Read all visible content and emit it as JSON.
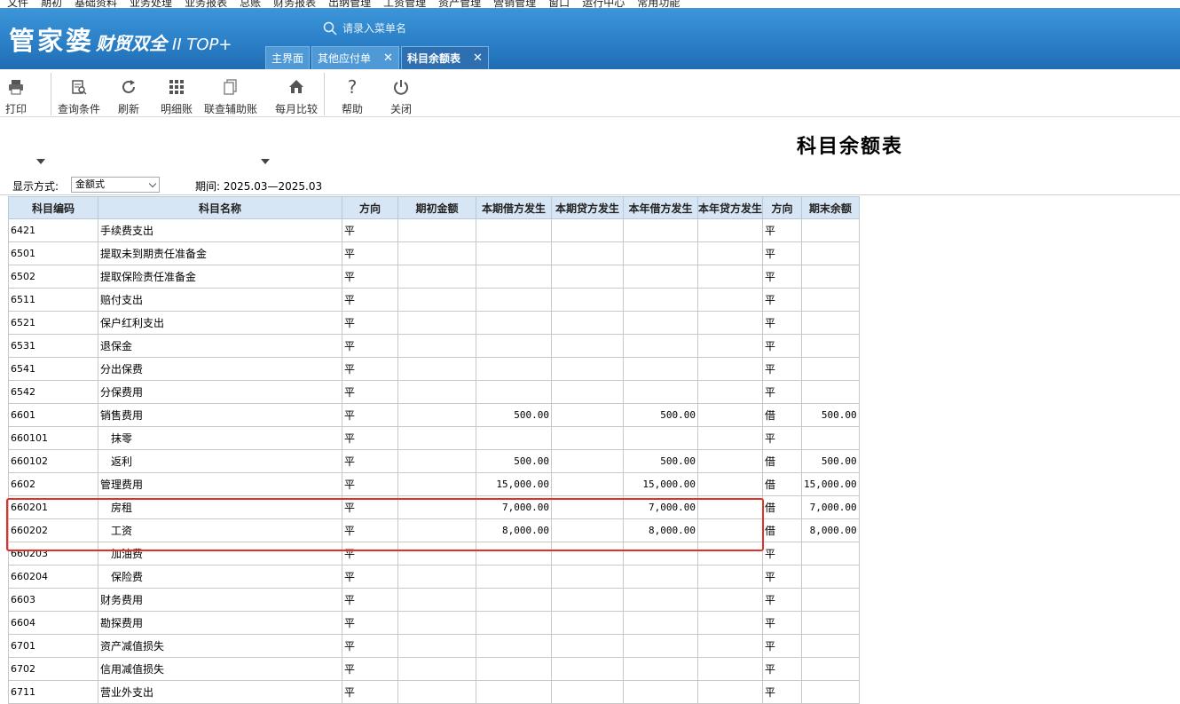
{
  "menubar": {
    "items": [
      "文件",
      "期初",
      "基础资料",
      "业务处理",
      "业务报表",
      "总账",
      "财务报表",
      "出纳管理",
      "工资管理",
      "资产管理",
      "營销管理",
      "窗口",
      "运行中心",
      "常用功能"
    ]
  },
  "brand": {
    "name": "管家婆",
    "subname": "财贸双全",
    "version": "II TOP+"
  },
  "search": {
    "placeholder": "请录入菜单名"
  },
  "tabs": [
    {
      "label": "主界面",
      "closable": false,
      "active": false
    },
    {
      "label": "其他应付单",
      "closable": true,
      "active": false
    },
    {
      "label": "科目余额表",
      "closable": true,
      "active": true
    }
  ],
  "toolbar": {
    "print": "打印",
    "query": "查询条件",
    "refresh": "刷新",
    "detail": "明细账",
    "linked": "联查辅助账",
    "monthly": "每月比较",
    "help": "帮助",
    "close": "关闭"
  },
  "report": {
    "title": "科目余额表",
    "display_mode_label": "显示方式:",
    "display_mode_value": "金额式",
    "period_label": "期间: 2025.03—2025.03"
  },
  "table": {
    "columns": [
      "科目编码",
      "科目名称",
      "方向",
      "期初金额",
      "本期借方发生",
      "本期贷方发生",
      "本年借方发生",
      "本年贷方发生",
      "方向",
      "期末余额"
    ],
    "rows": [
      {
        "code": "6421",
        "name": "手续费支出",
        "dir1": "平",
        "open": "",
        "cur_debit": "",
        "cur_credit": "",
        "ytd_debit": "",
        "ytd_credit": "",
        "dir2": "平",
        "end": ""
      },
      {
        "code": "6501",
        "name": "提取未到期责任准备金",
        "dir1": "平",
        "open": "",
        "cur_debit": "",
        "cur_credit": "",
        "ytd_debit": "",
        "ytd_credit": "",
        "dir2": "平",
        "end": ""
      },
      {
        "code": "6502",
        "name": "提取保险责任准备金",
        "dir1": "平",
        "open": "",
        "cur_debit": "",
        "cur_credit": "",
        "ytd_debit": "",
        "ytd_credit": "",
        "dir2": "平",
        "end": ""
      },
      {
        "code": "6511",
        "name": "赔付支出",
        "dir1": "平",
        "open": "",
        "cur_debit": "",
        "cur_credit": "",
        "ytd_debit": "",
        "ytd_credit": "",
        "dir2": "平",
        "end": ""
      },
      {
        "code": "6521",
        "name": "保户红利支出",
        "dir1": "平",
        "open": "",
        "cur_debit": "",
        "cur_credit": "",
        "ytd_debit": "",
        "ytd_credit": "",
        "dir2": "平",
        "end": ""
      },
      {
        "code": "6531",
        "name": "退保金",
        "dir1": "平",
        "open": "",
        "cur_debit": "",
        "cur_credit": "",
        "ytd_debit": "",
        "ytd_credit": "",
        "dir2": "平",
        "end": ""
      },
      {
        "code": "6541",
        "name": "分出保费",
        "dir1": "平",
        "open": "",
        "cur_debit": "",
        "cur_credit": "",
        "ytd_debit": "",
        "ytd_credit": "",
        "dir2": "平",
        "end": ""
      },
      {
        "code": "6542",
        "name": "分保费用",
        "dir1": "平",
        "open": "",
        "cur_debit": "",
        "cur_credit": "",
        "ytd_debit": "",
        "ytd_credit": "",
        "dir2": "平",
        "end": ""
      },
      {
        "code": "6601",
        "name": "销售费用",
        "dir1": "平",
        "open": "",
        "cur_debit": "500.00",
        "cur_credit": "",
        "ytd_debit": "500.00",
        "ytd_credit": "",
        "dir2": "借",
        "end": "500.00"
      },
      {
        "code": "660101",
        "name": "抹零",
        "child": true,
        "dir1": "平",
        "open": "",
        "cur_debit": "",
        "cur_credit": "",
        "ytd_debit": "",
        "ytd_credit": "",
        "dir2": "平",
        "end": ""
      },
      {
        "code": "660102",
        "name": "返利",
        "child": true,
        "dir1": "平",
        "open": "",
        "cur_debit": "500.00",
        "cur_credit": "",
        "ytd_debit": "500.00",
        "ytd_credit": "",
        "dir2": "借",
        "end": "500.00"
      },
      {
        "code": "6602",
        "name": "管理费用",
        "dir1": "平",
        "open": "",
        "cur_debit": "15,000.00",
        "cur_credit": "",
        "ytd_debit": "15,000.00",
        "ytd_credit": "",
        "dir2": "借",
        "end": "15,000.00"
      },
      {
        "code": "660201",
        "name": "房租",
        "child": true,
        "dir1": "平",
        "open": "",
        "cur_debit": "7,000.00",
        "cur_credit": "",
        "ytd_debit": "7,000.00",
        "ytd_credit": "",
        "dir2": "借",
        "end": "7,000.00"
      },
      {
        "code": "660202",
        "name": "工资",
        "child": true,
        "dir1": "平",
        "open": "",
        "cur_debit": "8,000.00",
        "cur_credit": "",
        "ytd_debit": "8,000.00",
        "ytd_credit": "",
        "dir2": "借",
        "end": "8,000.00"
      },
      {
        "code": "660203",
        "name": "加油费",
        "child": true,
        "dir1": "平",
        "open": "",
        "cur_debit": "",
        "cur_credit": "",
        "ytd_debit": "",
        "ytd_credit": "",
        "dir2": "平",
        "end": ""
      },
      {
        "code": "660204",
        "name": "保险费",
        "child": true,
        "dir1": "平",
        "open": "",
        "cur_debit": "",
        "cur_credit": "",
        "ytd_debit": "",
        "ytd_credit": "",
        "dir2": "平",
        "end": ""
      },
      {
        "code": "6603",
        "name": "财务费用",
        "dir1": "平",
        "open": "",
        "cur_debit": "",
        "cur_credit": "",
        "ytd_debit": "",
        "ytd_credit": "",
        "dir2": "平",
        "end": ""
      },
      {
        "code": "6604",
        "name": "勘探费用",
        "dir1": "平",
        "open": "",
        "cur_debit": "",
        "cur_credit": "",
        "ytd_debit": "",
        "ytd_credit": "",
        "dir2": "平",
        "end": ""
      },
      {
        "code": "6701",
        "name": "资产减值损失",
        "dir1": "平",
        "open": "",
        "cur_debit": "",
        "cur_credit": "",
        "ytd_debit": "",
        "ytd_credit": "",
        "dir2": "平",
        "end": ""
      },
      {
        "code": "6702",
        "name": "信用减值损失",
        "dir1": "平",
        "open": "",
        "cur_debit": "",
        "cur_credit": "",
        "ytd_debit": "",
        "ytd_credit": "",
        "dir2": "平",
        "end": ""
      },
      {
        "code": "6711",
        "name": "营业外支出",
        "dir1": "平",
        "open": "",
        "cur_debit": "",
        "cur_credit": "",
        "ytd_debit": "",
        "ytd_credit": "",
        "dir2": "平",
        "end": ""
      }
    ]
  },
  "colors": {
    "banner": "#2b80c8",
    "header_fill": "#d7e6f5",
    "highlight": "#e0302a"
  }
}
